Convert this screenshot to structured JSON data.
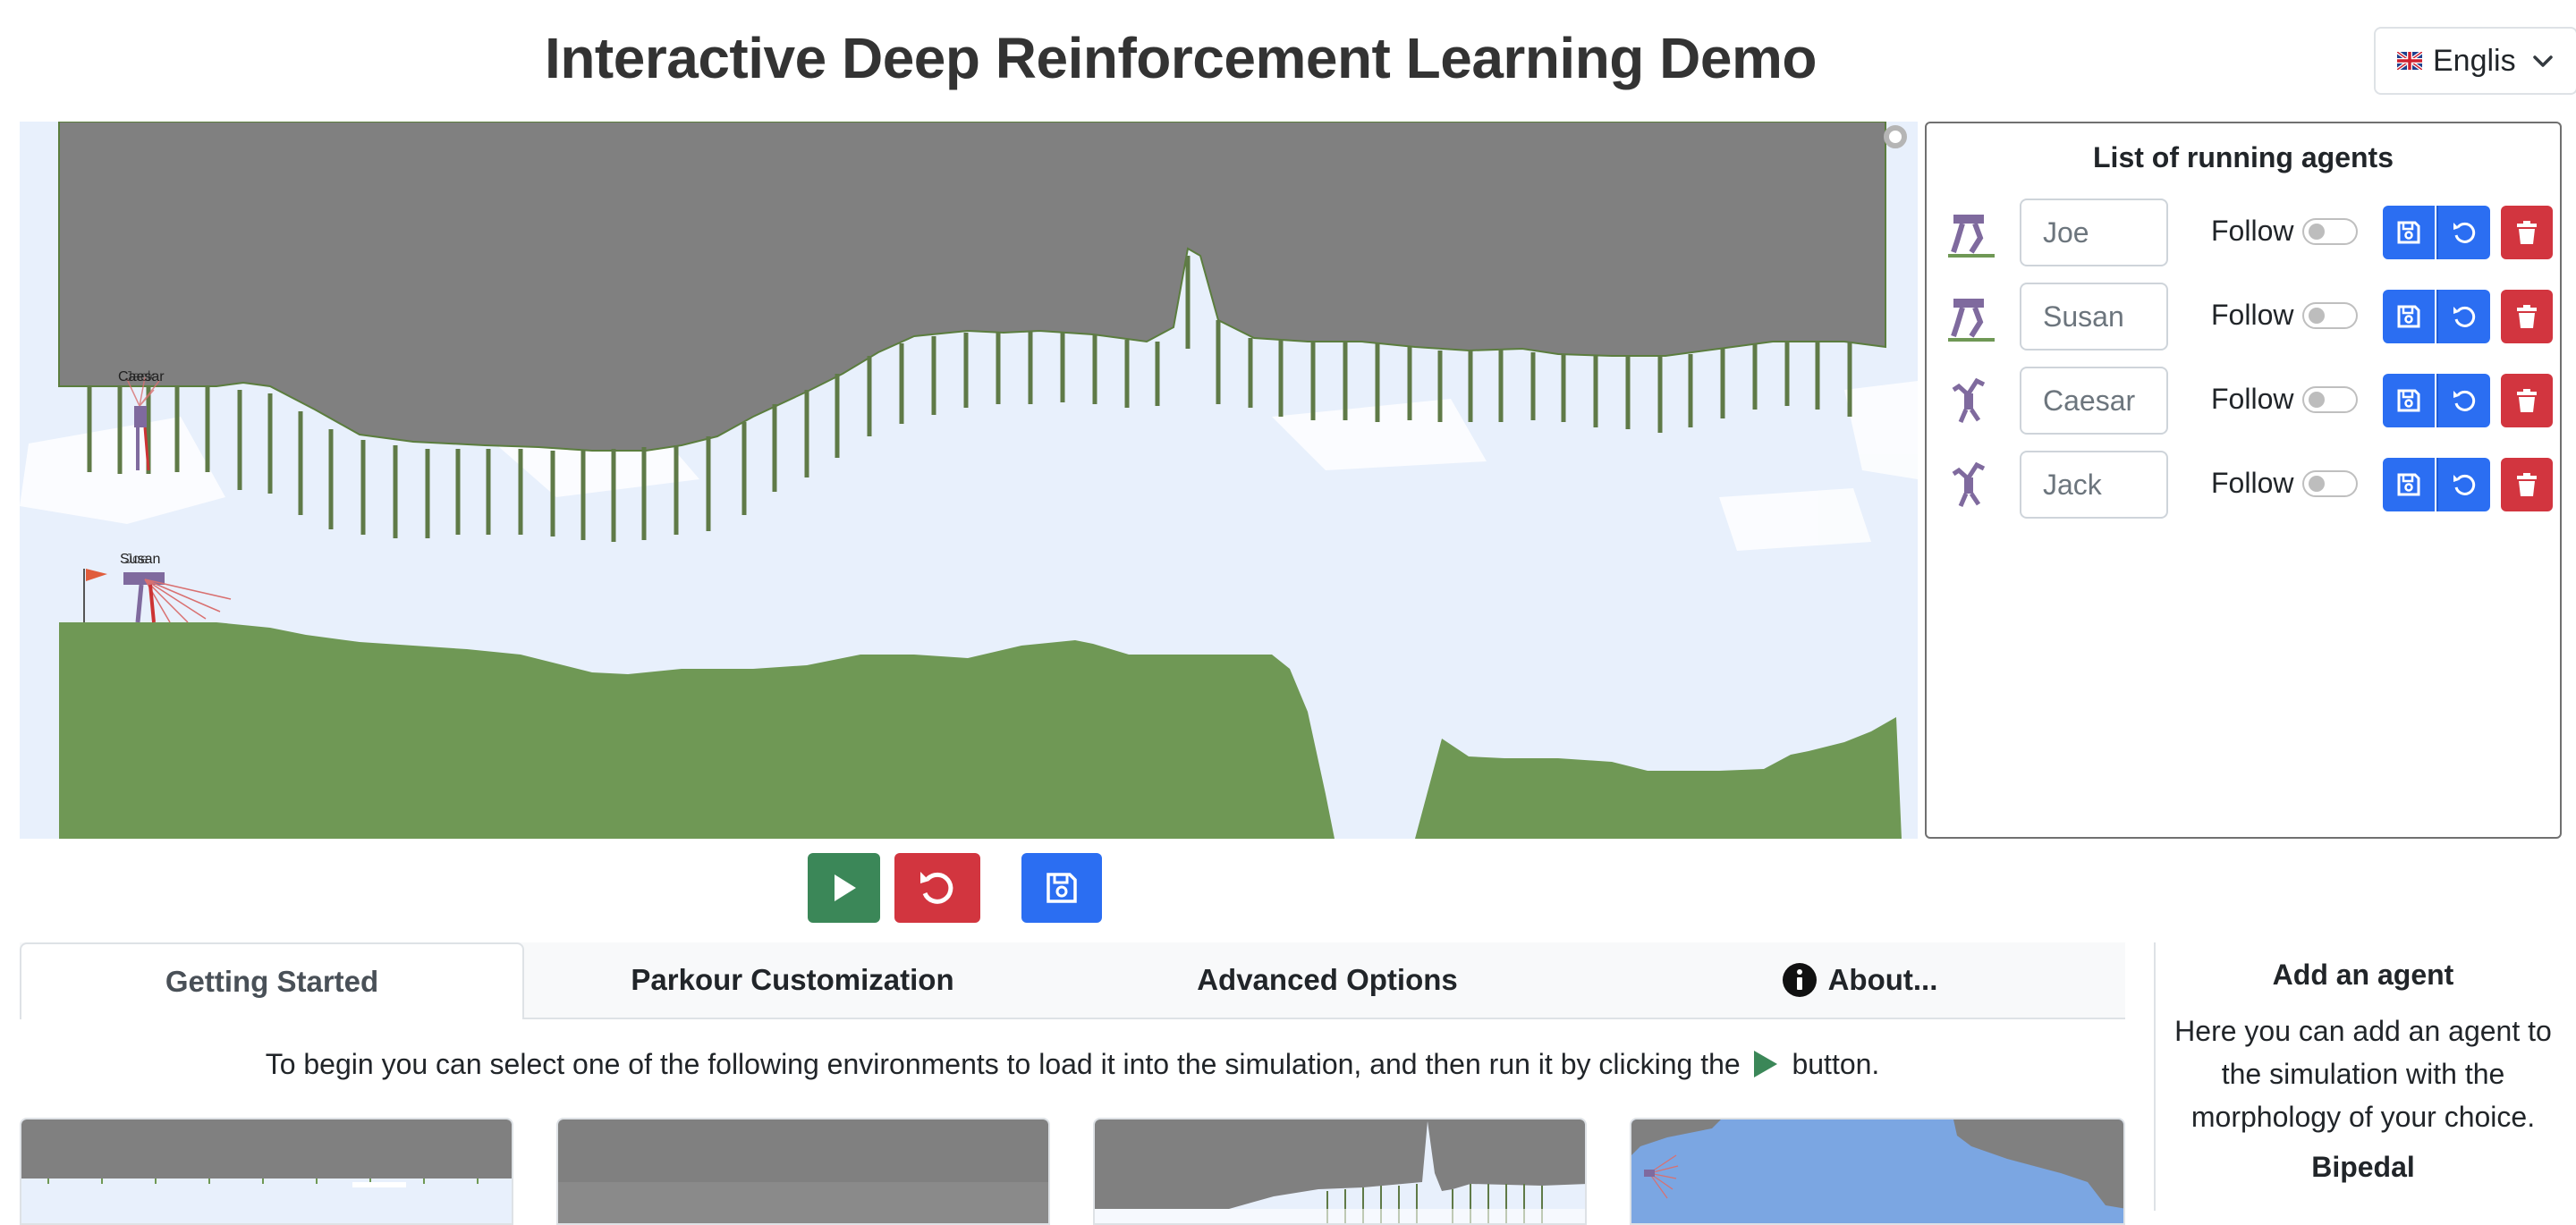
{
  "page": {
    "title": "Interactive Deep Reinforcement Learning Demo",
    "language": "Englis"
  },
  "simulation": {
    "agent_labels": [
      "Caesar",
      "Jack",
      "Susan",
      "Joe"
    ]
  },
  "agents_panel": {
    "title": "List of running agents",
    "follow_label": "Follow",
    "agents": [
      {
        "name": "Joe",
        "morphology": "bipedal",
        "follow": false
      },
      {
        "name": "Susan",
        "morphology": "bipedal",
        "follow": false
      },
      {
        "name": "Caesar",
        "morphology": "climber",
        "follow": false
      },
      {
        "name": "Jack",
        "morphology": "climber",
        "follow": false
      }
    ]
  },
  "controls": {
    "play": "play-icon",
    "reset": "reset-icon",
    "save": "save-icon"
  },
  "tabs": [
    {
      "label": "Getting Started",
      "active": true
    },
    {
      "label": "Parkour Customization",
      "active": false
    },
    {
      "label": "Advanced Options",
      "active": false
    },
    {
      "label": "About...",
      "active": false
    }
  ],
  "getting_started": {
    "intro_before": "To begin you can select one of the following environments to load it into the simulation, and then run it by clicking the",
    "intro_after": "button."
  },
  "add_agent": {
    "title": "Add an agent",
    "description": "Here you can add an agent to the simulation with the morphology of your choice.",
    "first_morphology": "Bipedal"
  },
  "colors": {
    "ground": "#6f9855",
    "ceiling": "#808080",
    "sky": "#e8f0fc",
    "play": "#3b8758",
    "reset": "#d2353f",
    "save": "#2b6ef2"
  }
}
